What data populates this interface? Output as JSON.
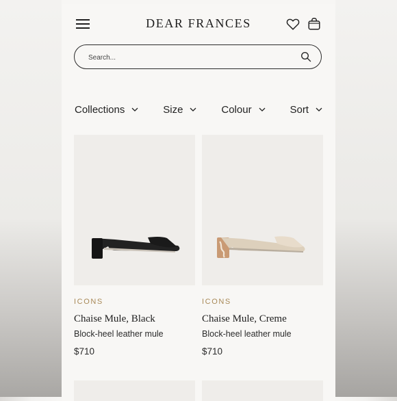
{
  "header": {
    "brand": "DEAR FRANCES"
  },
  "search": {
    "placeholder": "Search..."
  },
  "filters": [
    {
      "label": "Collections"
    },
    {
      "label": "Size"
    },
    {
      "label": "Colour"
    },
    {
      "label": "Sort"
    }
  ],
  "products": [
    {
      "category": "ICONS",
      "name": "Chaise Mule, Black",
      "description": "Block-heel leather mule",
      "price": "$710"
    },
    {
      "category": "ICONS",
      "name": "Chaise Mule, Creme",
      "description": "Block-heel leather mule",
      "price": "$710"
    }
  ],
  "colors": {
    "accent": "#a88957",
    "image_bg": "#efedea",
    "page_bg": "#f8f7f5"
  },
  "icons": [
    "menu-icon",
    "heart-icon",
    "bag-icon",
    "search-icon",
    "chevron-down-icon"
  ]
}
